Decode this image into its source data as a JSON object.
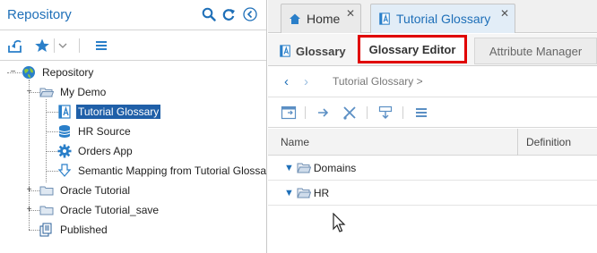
{
  "left_panel": {
    "title": "Repository",
    "header_icons": [
      "search-icon",
      "refresh-icon",
      "collapse-left-icon"
    ],
    "toolbar_icons": [
      "import-icon",
      "favorite-star-icon",
      "dropdown-chevron-icon",
      "menu-icon"
    ]
  },
  "tree": {
    "root": "Repository",
    "my_demo": "My Demo",
    "tutorial_glossary": "Tutorial Glossary",
    "hr_source": "HR Source",
    "orders_app": "Orders App",
    "semantic_mapping": "Semantic Mapping from Tutorial Glossa",
    "oracle_tutorial": "Oracle Tutorial",
    "oracle_tutorial_save": "Oracle Tutorial_save",
    "published": "Published"
  },
  "doc_tabs": [
    {
      "label": "Home",
      "close": "✕"
    },
    {
      "label": "Tutorial Glossary",
      "close": "✕"
    }
  ],
  "sub_tabs": {
    "glossary": "Glossary",
    "editor": "Glossary Editor",
    "attribute_manager": "Attribute Manager"
  },
  "breadcrumb": {
    "back": "‹",
    "forward": "›",
    "path": "Tutorial Glossary  >"
  },
  "grid": {
    "columns": [
      "Name",
      "Definition"
    ],
    "rows": [
      {
        "name": "Domains"
      },
      {
        "name": "HR"
      }
    ]
  },
  "colors": {
    "accent": "#1e6fb8",
    "selection": "#1f5fa8",
    "highlight_border": "#e00000"
  }
}
